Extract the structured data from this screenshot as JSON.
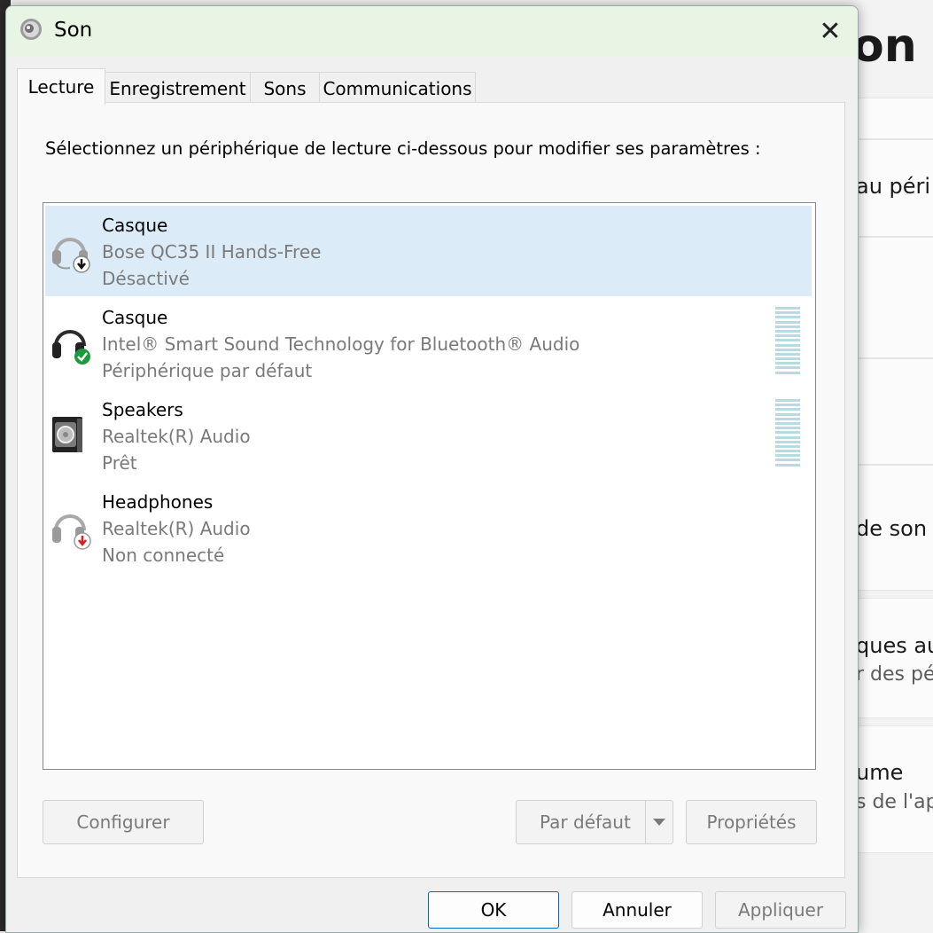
{
  "background_window": {
    "title_fragment": "on",
    "items": [
      {
        "text": "au péri",
        "sub": ""
      },
      {
        "text": "de son",
        "sub": ""
      },
      {
        "text": "ques au",
        "sub": "r des pé"
      },
      {
        "text": "ume",
        "sub": "s de l'ap"
      }
    ]
  },
  "dialog": {
    "title": "Son",
    "close_glyph": "✕",
    "tabs": [
      "Lecture",
      "Enregistrement",
      "Sons",
      "Communications"
    ],
    "instruction": "Sélectionnez un périphérique de lecture ci-dessous pour modifier ses paramètres :",
    "devices": [
      {
        "name": "Casque",
        "description": "Bose QC35 II Hands-Free",
        "status": "Désactivé",
        "icon": "headset-disabled-icon",
        "selected": true
      },
      {
        "name": "Casque",
        "description": "Intel® Smart Sound Technology for Bluetooth® Audio",
        "status": "Périphérique par défaut",
        "icon": "headphones-default-icon",
        "selected": false
      },
      {
        "name": "Speakers",
        "description": "Realtek(R) Audio",
        "status": "Prêt",
        "icon": "speaker-icon",
        "selected": false
      },
      {
        "name": "Headphones",
        "description": "Realtek(R) Audio",
        "status": "Non connecté",
        "icon": "headphones-unplugged-icon",
        "selected": false
      }
    ],
    "buttons": {
      "configure": "Configurer",
      "set_default": "Par défaut",
      "properties": "Propriétés",
      "ok": "OK",
      "cancel": "Annuler",
      "apply": "Appliquer"
    }
  },
  "colors": {
    "titlebar": "#e8f4e4",
    "selection": "#dbecf8",
    "accent": "#0067c0",
    "status_green": "#1a9a3a",
    "status_red": "#d42020"
  }
}
